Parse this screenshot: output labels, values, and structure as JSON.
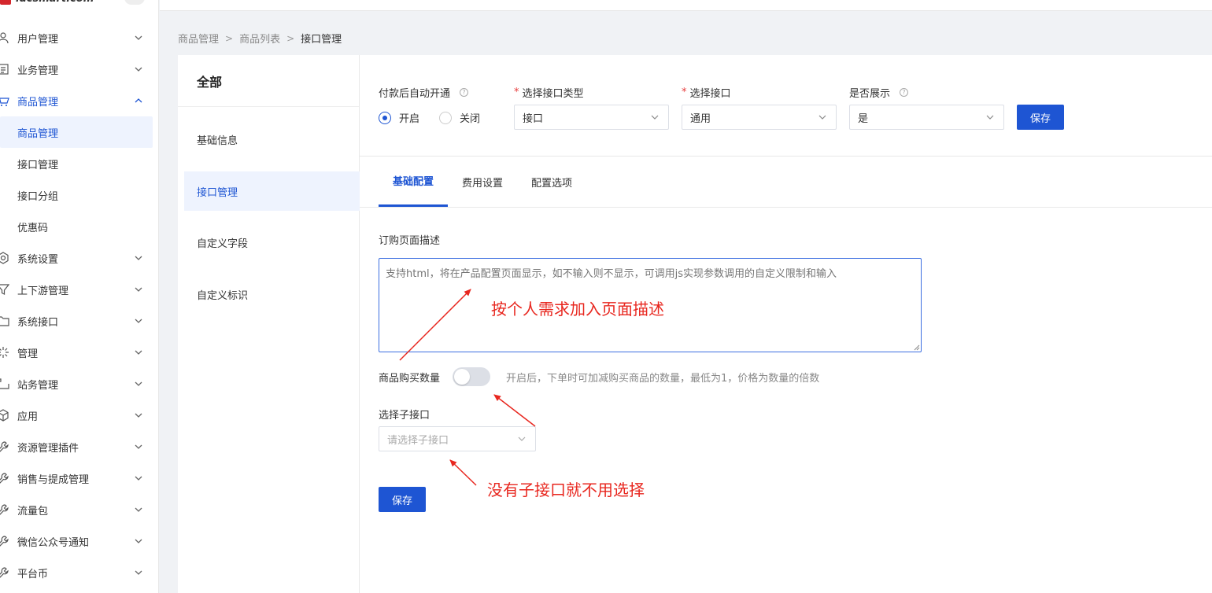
{
  "sidebar": {
    "items": [
      {
        "label": "用户管理",
        "icon": "user-icon"
      },
      {
        "label": "业务管理",
        "icon": "list-icon"
      },
      {
        "label": "商品管理",
        "icon": "cart-icon",
        "expanded": true
      },
      {
        "label": "系统设置",
        "icon": "gear-icon"
      },
      {
        "label": "上下游管理",
        "icon": "filter-icon"
      },
      {
        "label": "系统接口",
        "icon": "folder-icon"
      },
      {
        "label": "管理",
        "icon": "spark-icon"
      },
      {
        "label": "站务管理",
        "icon": "station-icon"
      },
      {
        "label": "应用",
        "icon": "cube-icon"
      },
      {
        "label": "资源管理插件",
        "icon": "wrench-icon"
      },
      {
        "label": "销售与提成管理",
        "icon": "wrench-icon"
      },
      {
        "label": "流量包",
        "icon": "wrench-icon"
      },
      {
        "label": "微信公众号通知",
        "icon": "wrench-icon"
      },
      {
        "label": "平台币",
        "icon": "wrench-icon"
      }
    ],
    "sub_items": [
      {
        "label": "商品管理",
        "active": true
      },
      {
        "label": "接口管理"
      },
      {
        "label": "接口分组"
      },
      {
        "label": "优惠码"
      }
    ]
  },
  "breadcrumb": [
    "商品管理",
    "商品列表",
    "接口管理"
  ],
  "left_panel": {
    "title": "全部",
    "tabs": [
      "基础信息",
      "接口管理",
      "自定义字段",
      "自定义标识"
    ],
    "active_tab": "接口管理"
  },
  "top_form": {
    "auto_open_label": "付款后自动开通",
    "radio_on": "开启",
    "radio_off": "关闭",
    "interface_type_label": "选择接口类型",
    "interface_type_value": "接口",
    "interface_label": "选择接口",
    "interface_value": "通用",
    "show_label": "是否展示",
    "show_value": "是",
    "save": "保存"
  },
  "config_tabs": [
    "基础配置",
    "费用设置",
    "配置选项"
  ],
  "basic_config": {
    "desc_label": "订购页面描述",
    "desc_placeholder": "支持html，将在产品配置页面显示，如不输入则不显示，可调用js实现参数调用的自定义限制和输入",
    "qty_label": "商品购买数量",
    "qty_hint": "开启后，下单时可加减购买商品的数量，最低为1，价格为数量的倍数",
    "sub_label": "选择子接口",
    "sub_placeholder": "请选择子接口",
    "save": "保存"
  },
  "annotations": {
    "desc_note": "按个人需求加入页面描述",
    "sub_note": "没有子接口就不用选择"
  },
  "colors": {
    "primary": "#1e55d3",
    "annotation": "#e8271f"
  }
}
